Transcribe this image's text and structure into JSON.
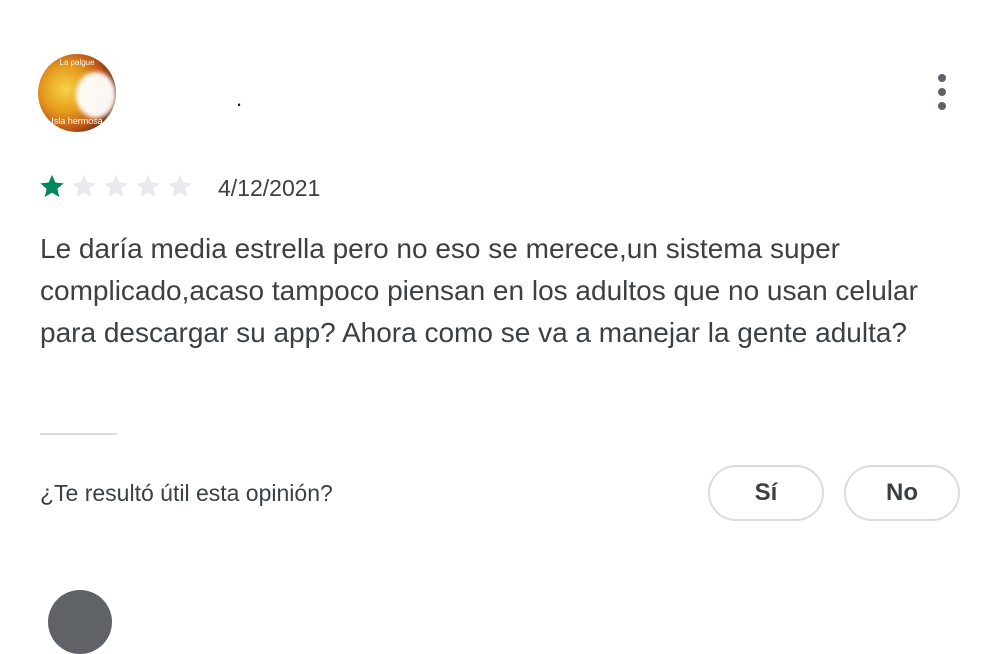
{
  "review": {
    "avatar": {
      "top_text": "La palgue",
      "bottom_text": "Isla hermosa"
    },
    "user_name": ".",
    "rating": {
      "value": 1,
      "max": 5,
      "filled_color": "#01875f",
      "empty_color": "#e8eaed"
    },
    "date": "4/12/2021",
    "text": "Le daría media estrella pero no eso se merece,un sistema super complicado,acaso tampoco piensan en los adultos que no usan celular para descargar su app? Ahora como se va a manejar la gente adulta?",
    "helpful": {
      "question": "¿Te resultó útil esta opinión?",
      "yes_label": "Sí",
      "no_label": "No"
    },
    "menu_icon": "more-vert-icon"
  }
}
